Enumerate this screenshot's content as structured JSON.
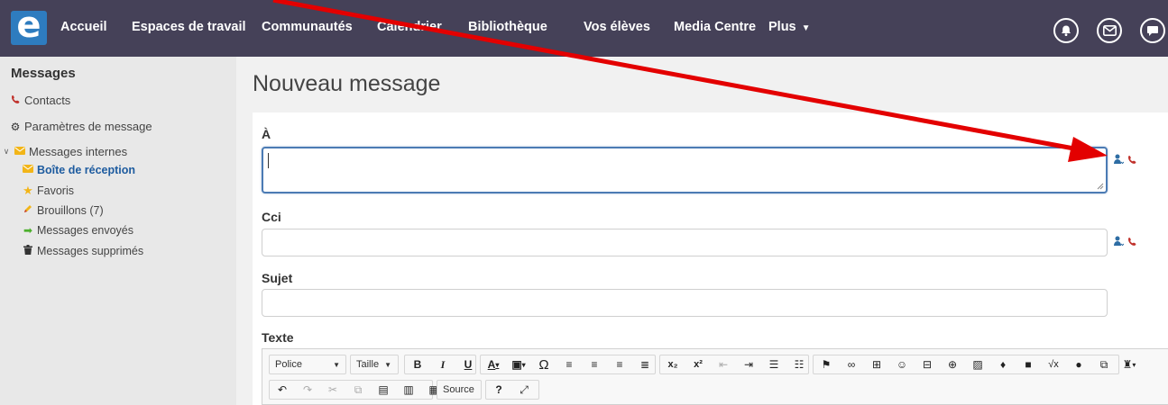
{
  "nav": {
    "logo_letter": "e",
    "items": [
      "Accueil",
      "Espaces de travail",
      "Communautés",
      "Calendrier",
      "Bibliothèque",
      "Vos élèves",
      "Media Centre",
      "Plus"
    ],
    "icons": [
      "bell-icon",
      "mail-icon",
      "chat-icon"
    ]
  },
  "sidebar": {
    "title": "Messages",
    "contacts": "Contacts",
    "settings": "Paramètres de message",
    "internal": "Messages internes",
    "folders": [
      {
        "label": "Boîte de réception",
        "icon": "inbox-icon",
        "active": true
      },
      {
        "label": "Favoris",
        "icon": "star-icon",
        "active": false
      },
      {
        "label": "Brouillons (7)",
        "icon": "pencil-icon",
        "active": false
      },
      {
        "label": "Messages envoyés",
        "icon": "arrow-right-icon",
        "active": false
      },
      {
        "label": "Messages supprimés",
        "icon": "trash-icon",
        "active": false
      }
    ]
  },
  "main": {
    "title": "Nouveau message",
    "to_label": "À",
    "to_value": "",
    "bcc_label": "Cci",
    "bcc_value": "",
    "subject_label": "Sujet",
    "subject_value": "",
    "text_label": "Texte"
  },
  "editor": {
    "font_combo": "Police",
    "size_combo": "Taille",
    "source_label": "Source",
    "help_label": "?"
  },
  "colors": {
    "topbar": "#454158",
    "accent": "#2e7cbf",
    "annotation_arrow": "#e30000"
  }
}
